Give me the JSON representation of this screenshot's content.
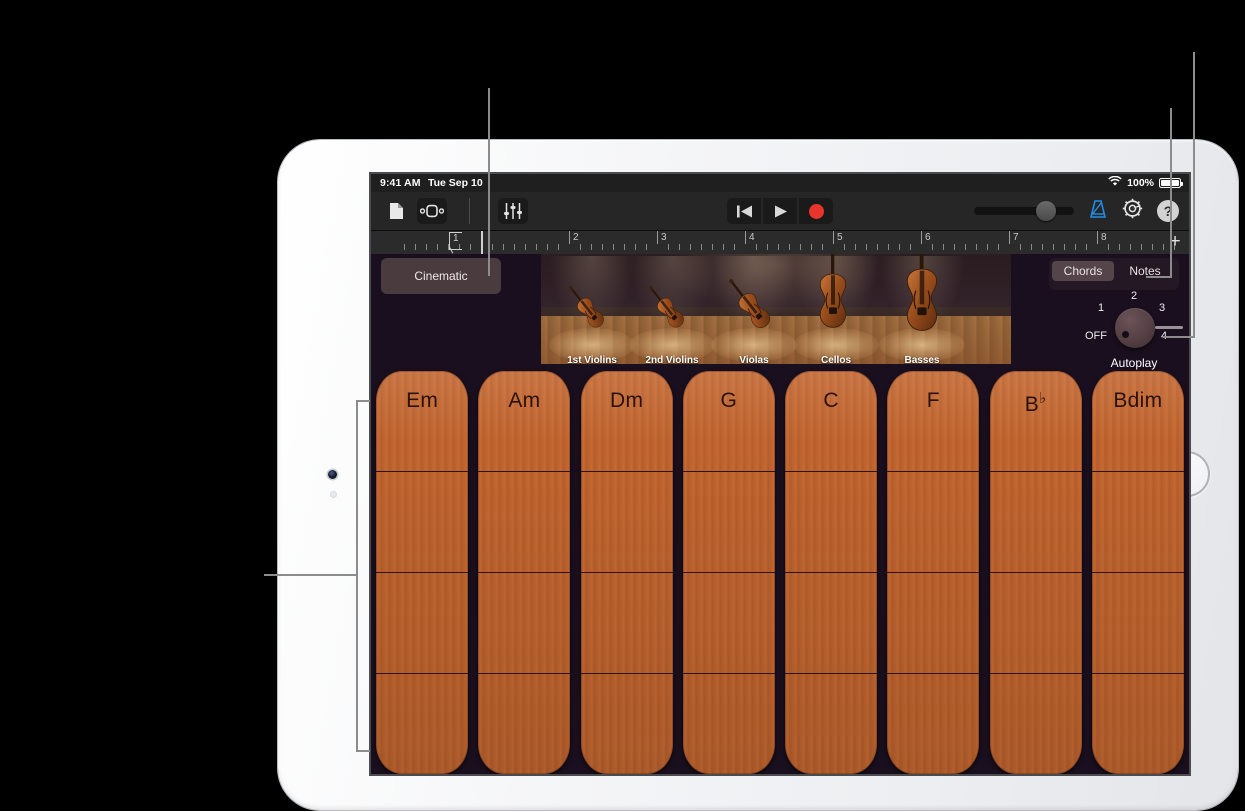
{
  "status_bar": {
    "time": "9:41 AM",
    "date": "Tue Sep 10",
    "battery_percent": "100%",
    "wifi_icon": "wifi-icon",
    "battery_icon": "battery-full-icon"
  },
  "toolbar": {
    "navigation_icon": "document-navigation-icon",
    "loop_browser_icon": "track-view-icon",
    "mixer_icon": "mixer-sliders-icon",
    "rewind_icon": "rewind-to-start-icon",
    "play_icon": "play-icon",
    "record_icon": "record-icon",
    "volume_value": "62",
    "metronome_icon": "metronome-icon",
    "metronome_active_color": "#1e8fe8",
    "settings_icon": "settings-gear-icon",
    "help_label": "?"
  },
  "ruler": {
    "bars": [
      "1",
      "2",
      "3",
      "4",
      "5",
      "6",
      "7",
      "8"
    ],
    "add_section_label": "+",
    "playhead_bar": "1"
  },
  "track": {
    "name": "Cinematic"
  },
  "mode_toggle": {
    "options": [
      "Chords",
      "Notes"
    ],
    "selected": "Chords"
  },
  "stage": {
    "sections": [
      {
        "label": "1st Violins",
        "type": "violin"
      },
      {
        "label": "2nd Violins",
        "type": "violin"
      },
      {
        "label": "Violas",
        "type": "viola"
      },
      {
        "label": "Cellos",
        "type": "cello"
      },
      {
        "label": "Basses",
        "type": "bass"
      }
    ]
  },
  "autoplay": {
    "label": "Autoplay",
    "positions": [
      "OFF",
      "1",
      "2",
      "3",
      "4"
    ],
    "selected": "OFF"
  },
  "chords": {
    "rows": 4,
    "items": [
      {
        "name": "Em",
        "root": "Em",
        "accidental": ""
      },
      {
        "name": "Am",
        "root": "Am",
        "accidental": ""
      },
      {
        "name": "Dm",
        "root": "Dm",
        "accidental": ""
      },
      {
        "name": "G",
        "root": "G",
        "accidental": ""
      },
      {
        "name": "C",
        "root": "C",
        "accidental": ""
      },
      {
        "name": "F",
        "root": "F",
        "accidental": ""
      },
      {
        "name": "Bb",
        "root": "B",
        "accidental": "♭"
      },
      {
        "name": "Bdim",
        "root": "Bdim",
        "accidental": ""
      }
    ]
  },
  "colors": {
    "chord_strip": "#c2652f",
    "screen_background": "#1a0f1e",
    "toolbar_background": "#262626",
    "accent_blue": "#1e8fe8",
    "record_red": "#e8352c",
    "track_header": "#4a3b3f"
  }
}
